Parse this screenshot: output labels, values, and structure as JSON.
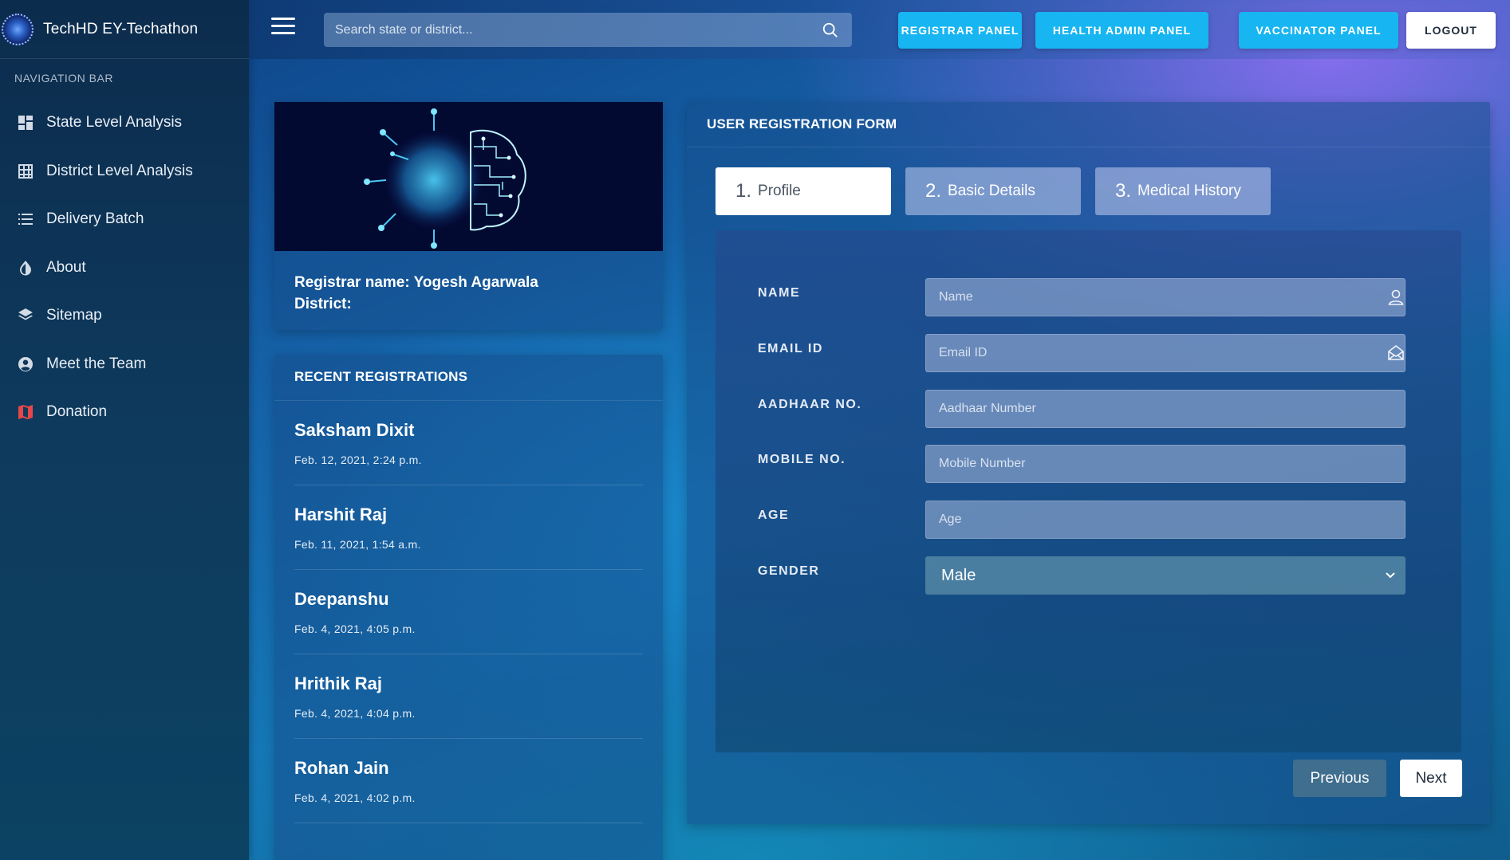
{
  "app": {
    "title": "TechHD EY-Techathon"
  },
  "sidebar": {
    "caption": "NAVIGATION BAR",
    "items": [
      {
        "label": "State Level Analysis",
        "icon": "dashboard-icon"
      },
      {
        "label": "District Level Analysis",
        "icon": "table-icon"
      },
      {
        "label": "Delivery Batch",
        "icon": "list-icon"
      },
      {
        "label": "About",
        "icon": "contrast-icon"
      },
      {
        "label": "Sitemap",
        "icon": "layers-icon"
      },
      {
        "label": "Meet the Team",
        "icon": "user-circle-icon"
      },
      {
        "label": "Donation",
        "icon": "map-icon"
      }
    ]
  },
  "topbar": {
    "search_placeholder": "Search state or district...",
    "buttons": {
      "registrar": "REGISTRAR PANEL",
      "health_admin": "HEALTH ADMIN PANEL",
      "vaccinator": "VACCINATOR PANEL",
      "logout": "LOGOUT"
    }
  },
  "registrar": {
    "name_line": "Registrar name: Yogesh Agarwala",
    "district_line": "District:"
  },
  "recent": {
    "title": "RECENT REGISTRATIONS",
    "items": [
      {
        "name": "Saksham Dixit",
        "time": "Feb. 12, 2021, 2:24 p.m."
      },
      {
        "name": "Harshit Raj",
        "time": "Feb. 11, 2021, 1:54 a.m."
      },
      {
        "name": "Deepanshu",
        "time": "Feb. 4, 2021, 4:05 p.m."
      },
      {
        "name": "Hrithik Raj",
        "time": "Feb. 4, 2021, 4:04 p.m."
      },
      {
        "name": "Rohan Jain",
        "time": "Feb. 4, 2021, 4:02 p.m."
      }
    ]
  },
  "form": {
    "title": "USER REGISTRATION FORM",
    "tabs": [
      {
        "num": "1.",
        "label": "Profile",
        "active": true
      },
      {
        "num": "2.",
        "label": "Basic Details",
        "active": false
      },
      {
        "num": "3.",
        "label": "Medical History",
        "active": false
      }
    ],
    "fields": {
      "name": {
        "label": "NAME",
        "placeholder": "Name",
        "value": ""
      },
      "email": {
        "label": "EMAIL ID",
        "placeholder": "Email ID",
        "value": ""
      },
      "aadhaar": {
        "label": "AADHAAR NO.",
        "placeholder": "Aadhaar Number",
        "value": ""
      },
      "mobile": {
        "label": "MOBILE NO.",
        "placeholder": "Mobile Number",
        "value": ""
      },
      "age": {
        "label": "AGE",
        "placeholder": "Age",
        "value": ""
      },
      "gender": {
        "label": "GENDER",
        "selected": "Male"
      }
    },
    "previous_label": "Previous",
    "next_label": "Next"
  },
  "colors": {
    "accent_button": "#17b5f1",
    "donation_icon": "#e8474a"
  }
}
